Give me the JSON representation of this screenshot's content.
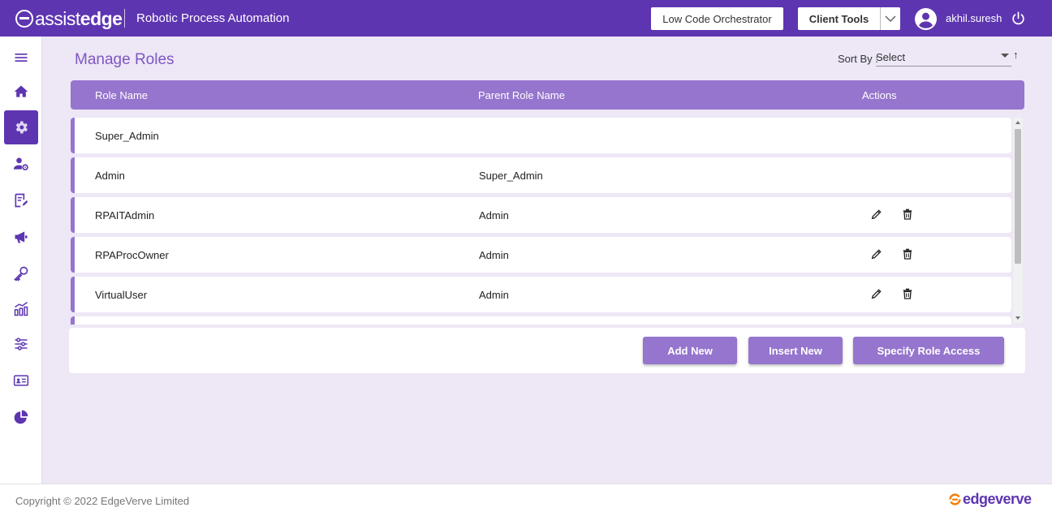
{
  "header": {
    "logo_light": "assist",
    "logo_bold": "edge",
    "app_title": "Robotic Process Automation",
    "low_code_label": "Low Code Orchestrator",
    "client_tools_label": "Client Tools",
    "username": "akhil.suresh"
  },
  "sidebar": {
    "items": [
      {
        "icon": "menu-icon"
      },
      {
        "icon": "home-icon"
      },
      {
        "icon": "gear-icon",
        "active": true
      },
      {
        "icon": "user-settings-icon"
      },
      {
        "icon": "document-edit-icon"
      },
      {
        "icon": "megaphone-icon"
      },
      {
        "icon": "key-icon"
      },
      {
        "icon": "chart-icon"
      },
      {
        "icon": "sliders-icon"
      },
      {
        "icon": "id-card-icon"
      },
      {
        "icon": "pie-chart-icon"
      }
    ]
  },
  "page": {
    "title": "Manage Roles",
    "sort_label": "Sort By :",
    "sort_value": "Select",
    "sort_direction": "↑"
  },
  "table": {
    "columns": [
      "Role Name",
      "Parent Role Name",
      "Actions"
    ],
    "rows": [
      {
        "role": "Super_Admin",
        "parent": "",
        "actions": false
      },
      {
        "role": "Admin",
        "parent": "Super_Admin",
        "actions": false
      },
      {
        "role": "RPAITAdmin",
        "parent": "Admin",
        "actions": true
      },
      {
        "role": "RPAProcOwner",
        "parent": "Admin",
        "actions": true
      },
      {
        "role": "VirtualUser",
        "parent": "Admin",
        "actions": true
      }
    ]
  },
  "buttons": {
    "add_new": "Add New",
    "insert_new": "Insert New",
    "specify_role_access": "Specify Role Access"
  },
  "footer": {
    "copyright": "Copyright © 2022 EdgeVerve Limited",
    "brand": "edgeverve"
  },
  "colors": {
    "primary": "#5e35b1",
    "accent": "#9575cd",
    "background": "#ede7f6",
    "brand_orange": "#f57c00"
  }
}
